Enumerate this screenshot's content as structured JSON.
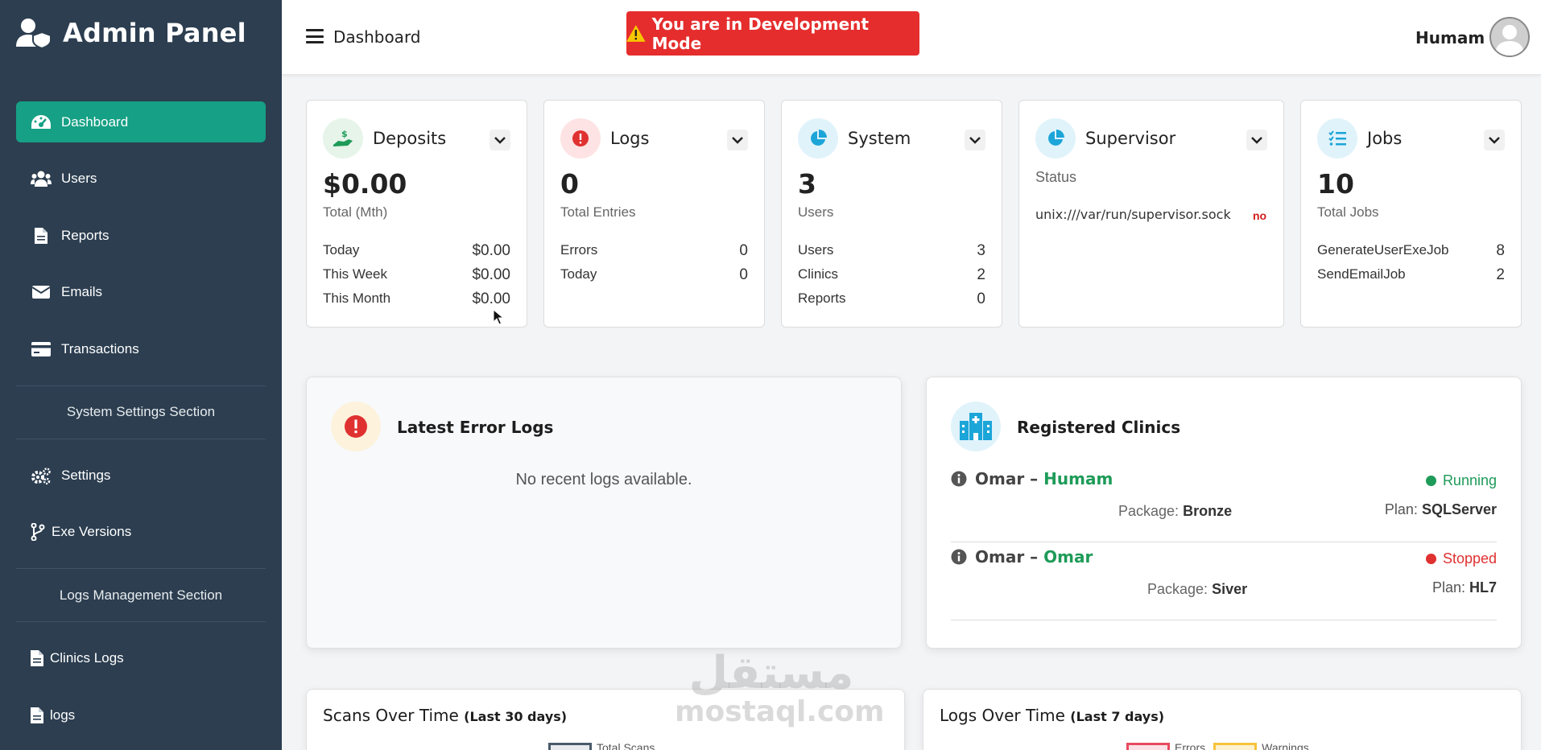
{
  "sidebar": {
    "brand": "Admin Panel",
    "items": [
      {
        "label": "Dashboard",
        "icon": "gauge-icon",
        "active": true
      },
      {
        "label": "Users",
        "icon": "users-icon"
      },
      {
        "label": "Reports",
        "icon": "file-icon"
      },
      {
        "label": "Emails",
        "icon": "envelope-icon"
      },
      {
        "label": "Transactions",
        "icon": "credit-card-icon"
      }
    ],
    "section1": "System Settings Section",
    "items2": [
      {
        "label": "Settings",
        "icon": "gears-icon"
      },
      {
        "label": "Exe Versions",
        "icon": "code-branch-icon"
      }
    ],
    "section2": "Logs Management Section",
    "items3": [
      {
        "label": "Clinics Logs",
        "icon": "file-icon"
      },
      {
        "label": "logs",
        "icon": "file-icon"
      }
    ]
  },
  "topbar": {
    "breadcrumb": "Dashboard",
    "dev_banner": "You are in Development Mode",
    "user_name": "Humam"
  },
  "cards": {
    "deposits": {
      "title": "Deposits",
      "value": "$0.00",
      "sub": "Total (Mth)",
      "rows": [
        {
          "k": "Today",
          "v": "$0.00"
        },
        {
          "k": "This Week",
          "v": "$0.00"
        },
        {
          "k": "This Month",
          "v": "$0.00"
        }
      ]
    },
    "logs": {
      "title": "Logs",
      "value": "0",
      "sub": "Total Entries",
      "rows": [
        {
          "k": "Errors",
          "v": "0"
        },
        {
          "k": "Today",
          "v": "0"
        }
      ]
    },
    "system": {
      "title": "System",
      "value": "3",
      "sub": "Users",
      "rows": [
        {
          "k": "Users",
          "v": "3"
        },
        {
          "k": "Clinics",
          "v": "2"
        },
        {
          "k": "Reports",
          "v": "0"
        }
      ]
    },
    "supervisor": {
      "title": "Supervisor",
      "status_label": "Status",
      "socket": "unix:///var/run/supervisor.sock",
      "state": "no"
    },
    "jobs": {
      "title": "Jobs",
      "value": "10",
      "sub": "Total Jobs",
      "rows": [
        {
          "k": "GenerateUserExeJob",
          "v": "8"
        },
        {
          "k": "SendEmailJob",
          "v": "2"
        }
      ]
    }
  },
  "error_logs": {
    "title": "Latest Error Logs",
    "empty": "No recent logs available."
  },
  "clinics": {
    "title": "Registered Clinics",
    "items": [
      {
        "owner": "Omar",
        "name": "Humam",
        "status": "Running",
        "status_color": "#1e9b58",
        "package_label": "Package:",
        "package": "Bronze",
        "plan_label": "Plan:",
        "plan": "SQLServer"
      },
      {
        "owner": "Omar",
        "name": "Omar",
        "status": "Stopped",
        "status_color": "#e03131",
        "package_label": "Package:",
        "package": "Siver",
        "plan_label": "Plan:",
        "plan": "HL7"
      }
    ]
  },
  "charts": {
    "scans": {
      "title": "Scans Over Time",
      "period": "(Last 30 days)",
      "legend": "Total Scans"
    },
    "logs": {
      "title": "Logs Over Time",
      "period": "(Last 7 days)",
      "legend_errors": "Errors",
      "legend_warnings": "Warnings"
    }
  },
  "watermark": {
    "arabic": "مستقل",
    "latin": "mostaql.com"
  }
}
